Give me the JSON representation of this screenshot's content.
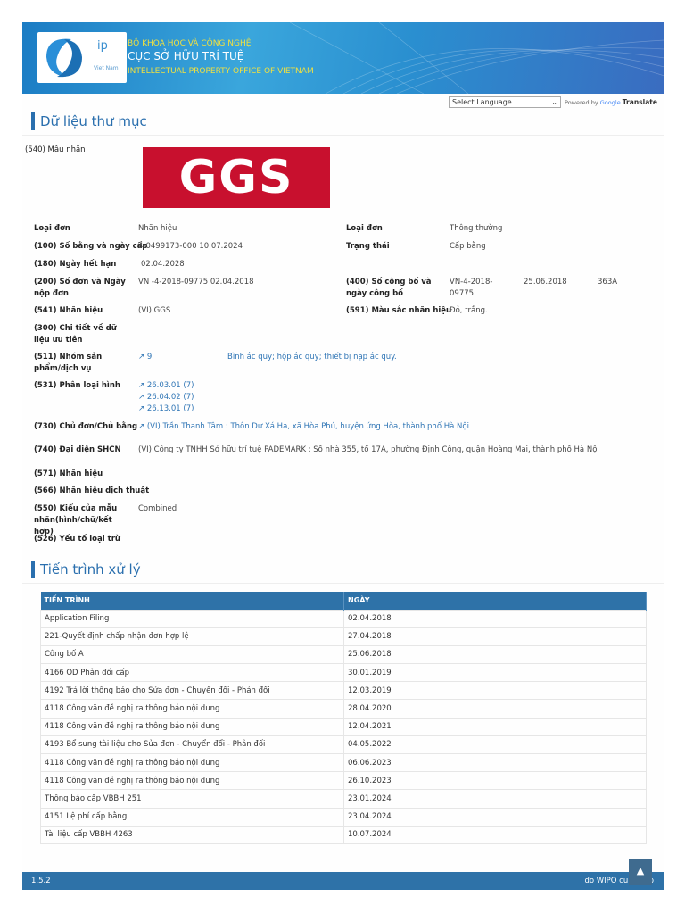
{
  "header": {
    "logo_ip": "ip",
    "logo_vn": "Viet Nam",
    "ministry": "BỘ KHOA HỌC VÀ CÔNG NGHỆ",
    "office": "CỤC SỞ HỮU TRÍ TUỆ",
    "office_en": "INTELLECTUAL PROPERTY OFFICE OF VIETNAM"
  },
  "translate": {
    "select": "Select Language",
    "powered": "Powered by",
    "google": "Google",
    "translate": "Translate"
  },
  "section1": {
    "title": "Dữ liệu thư mục"
  },
  "mark_image": {
    "label": "(540) Mẫu nhãn",
    "logo_text": "GGS"
  },
  "fields": {
    "type_l": "Loại đơn",
    "type_v": "Nhãn hiệu",
    "type2_l": "Loại đơn",
    "type2_v": "Thông thường",
    "f100_l": "(100) Số bằng và ngày cấp",
    "f100_v": "4-0499173-000  10.07.2024",
    "status_l": "Trạng thái",
    "status_v": "Cấp bằng",
    "f180_l": "(180) Ngày hết hạn",
    "f180_v": "02.04.2028",
    "f200_l": "(200) Số đơn và Ngày nộp đơn",
    "f200_v": "VN -4-2018-09775  02.04.2018",
    "f400_l": "(400) Số công bố và ngày công bố",
    "f400_v1": "VN-4-2018-09775",
    "f400_v2": "25.06.2018",
    "f400_v3": "363A",
    "f541_l": "(541) Nhãn hiệu",
    "f541_v": "(VI) GGS",
    "f591_l": "(591) Màu sắc nhãn hiệu",
    "f591_v": "Đỏ, trắng.",
    "f300_l": "(300) Chi tiết về dữ liệu ưu tiên",
    "f511_l": "(511) Nhóm sản phẩm/dịch vụ",
    "f511_class": "9",
    "f511_desc": "Bình ắc quy; hộp ắc quy; thiết bị nạp ắc quy.",
    "f531_l": "(531) Phân loại hình",
    "f531_v": [
      "26.03.01 (7)",
      "26.04.02 (7)",
      "26.13.01 (7)"
    ],
    "f730_l": "(730) Chủ đơn/Chủ bằng",
    "f730_v": "(VI) Trần Thanh Tâm : Thôn Dư Xá Hạ, xã Hòa Phú, huyện ứng Hòa, thành phố Hà Nội",
    "f740_l": "(740) Đại diện SHCN",
    "f740_v": "(VI) Công ty TNHH Sở hữu trí tuệ PADEMARK : Số nhà 355, tổ 17A, phường Định Công, quận Hoàng Mai, thành phố Hà Nội",
    "f571_l": "(571) Nhãn hiệu",
    "f566_l": "(566) Nhãn hiệu dịch thuật",
    "f550_l": "(550) Kiểu của mẫu nhãn(hình/chữ/kết hợp)",
    "f550_v": "Combined",
    "f526_l": "(526) Yếu tố loại trừ"
  },
  "section2": {
    "title": "Tiến trình xử lý"
  },
  "process": {
    "headers": [
      "TIẾN TRÌNH",
      "NGÀY"
    ],
    "rows": [
      [
        "Application Filing",
        "02.04.2018"
      ],
      [
        "221-Quyết định chấp nhận đơn hợp lệ",
        "27.04.2018"
      ],
      [
        "Công bố A",
        "25.06.2018"
      ],
      [
        "4166 OD Phản đối cấp",
        "30.01.2019"
      ],
      [
        "4192 Trả lời thông báo cho Sửa đơn - Chuyển đổi - Phản đối",
        "12.03.2019"
      ],
      [
        "4118 Công văn đề nghị ra thông báo nội dung",
        "28.04.2020"
      ],
      [
        "4118 Công văn đề nghị ra thông báo nội dung",
        "12.04.2021"
      ],
      [
        "4193 Bổ sung tài liệu cho Sửa đơn - Chuyển đổi - Phản đối",
        "04.05.2022"
      ],
      [
        "4118 Công văn đề nghị ra thông báo nội dung",
        "06.06.2023"
      ],
      [
        "4118 Công văn đề nghị ra thông báo nội dung",
        "26.10.2023"
      ],
      [
        "Thông báo cấp VBBH 251",
        "23.01.2024"
      ],
      [
        "4151 Lệ phí cấp bằng",
        "23.04.2024"
      ],
      [
        "Tài liệu cấp VBBH 4263",
        "10.07.2024"
      ]
    ]
  },
  "footer": {
    "version": "1.5.2",
    "credit": "do WIPO cung cấp",
    "top": "▲"
  }
}
